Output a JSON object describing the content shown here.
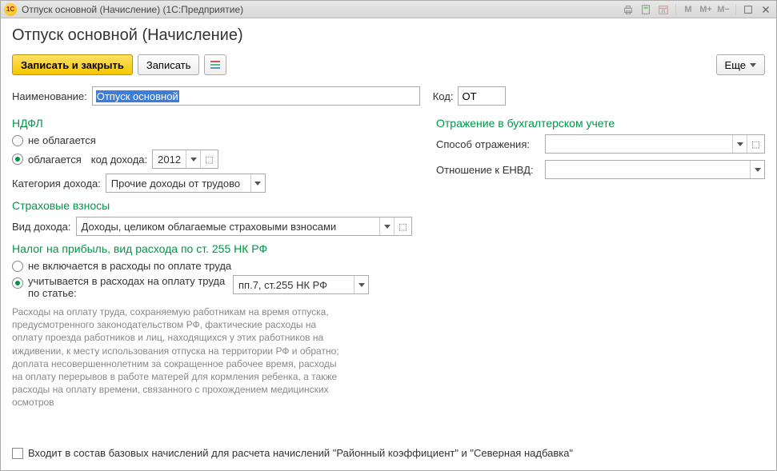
{
  "titlebar": {
    "text": "Отпуск основной (Начисление) (1С:Предприятие)"
  },
  "page_title": "Отпуск основной (Начисление)",
  "toolbar": {
    "save_close": "Записать и закрыть",
    "save": "Записать",
    "more": "Еще"
  },
  "fields": {
    "name_label": "Наименование:",
    "name_value": "Отпуск основной",
    "code_label": "Код:",
    "code_value": "ОТ"
  },
  "ndfl": {
    "heading": "НДФЛ",
    "not_taxed": "не облагается",
    "taxed": "облагается",
    "income_code_label": "код дохода:",
    "income_code_value": "2012",
    "category_label": "Категория дохода:",
    "category_value": "Прочие доходы от трудово"
  },
  "accounting": {
    "heading": "Отражение в бухгалтерском учете",
    "method_label": "Способ отражения:",
    "method_value": "",
    "envd_label": "Отношение к ЕНВД:",
    "envd_value": ""
  },
  "insurance": {
    "heading": "Страховые взносы",
    "type_label": "Вид дохода:",
    "type_value": "Доходы, целиком облагаемые страховыми взносами"
  },
  "profit_tax": {
    "heading": "Налог на прибыль, вид расхода по ст. 255 НК РФ",
    "not_included": "не включается в расходы по оплате труда",
    "included": "учитывается в расходах на оплату труда по статье:",
    "article_value": "пп.7, ст.255 НК РФ",
    "hint": "Расходы на оплату труда, сохраняемую работникам на время отпуска, предусмотренного законодательством РФ, фактические расходы на оплату проезда работников и лиц, находящихся у этих работников на иждивении, к месту использования отпуска на территории РФ и обратно; доплата несовершеннолетним за сокращенное рабочее время, расходы на оплату перерывов в работе матерей для кормления ребенка, а также расходы на оплату времени, связанного с прохождением медицинских осмотров"
  },
  "footer": {
    "checkbox_label": "Входит в состав базовых начислений для расчета начислений \"Районный коэффициент\" и \"Северная надбавка\""
  }
}
